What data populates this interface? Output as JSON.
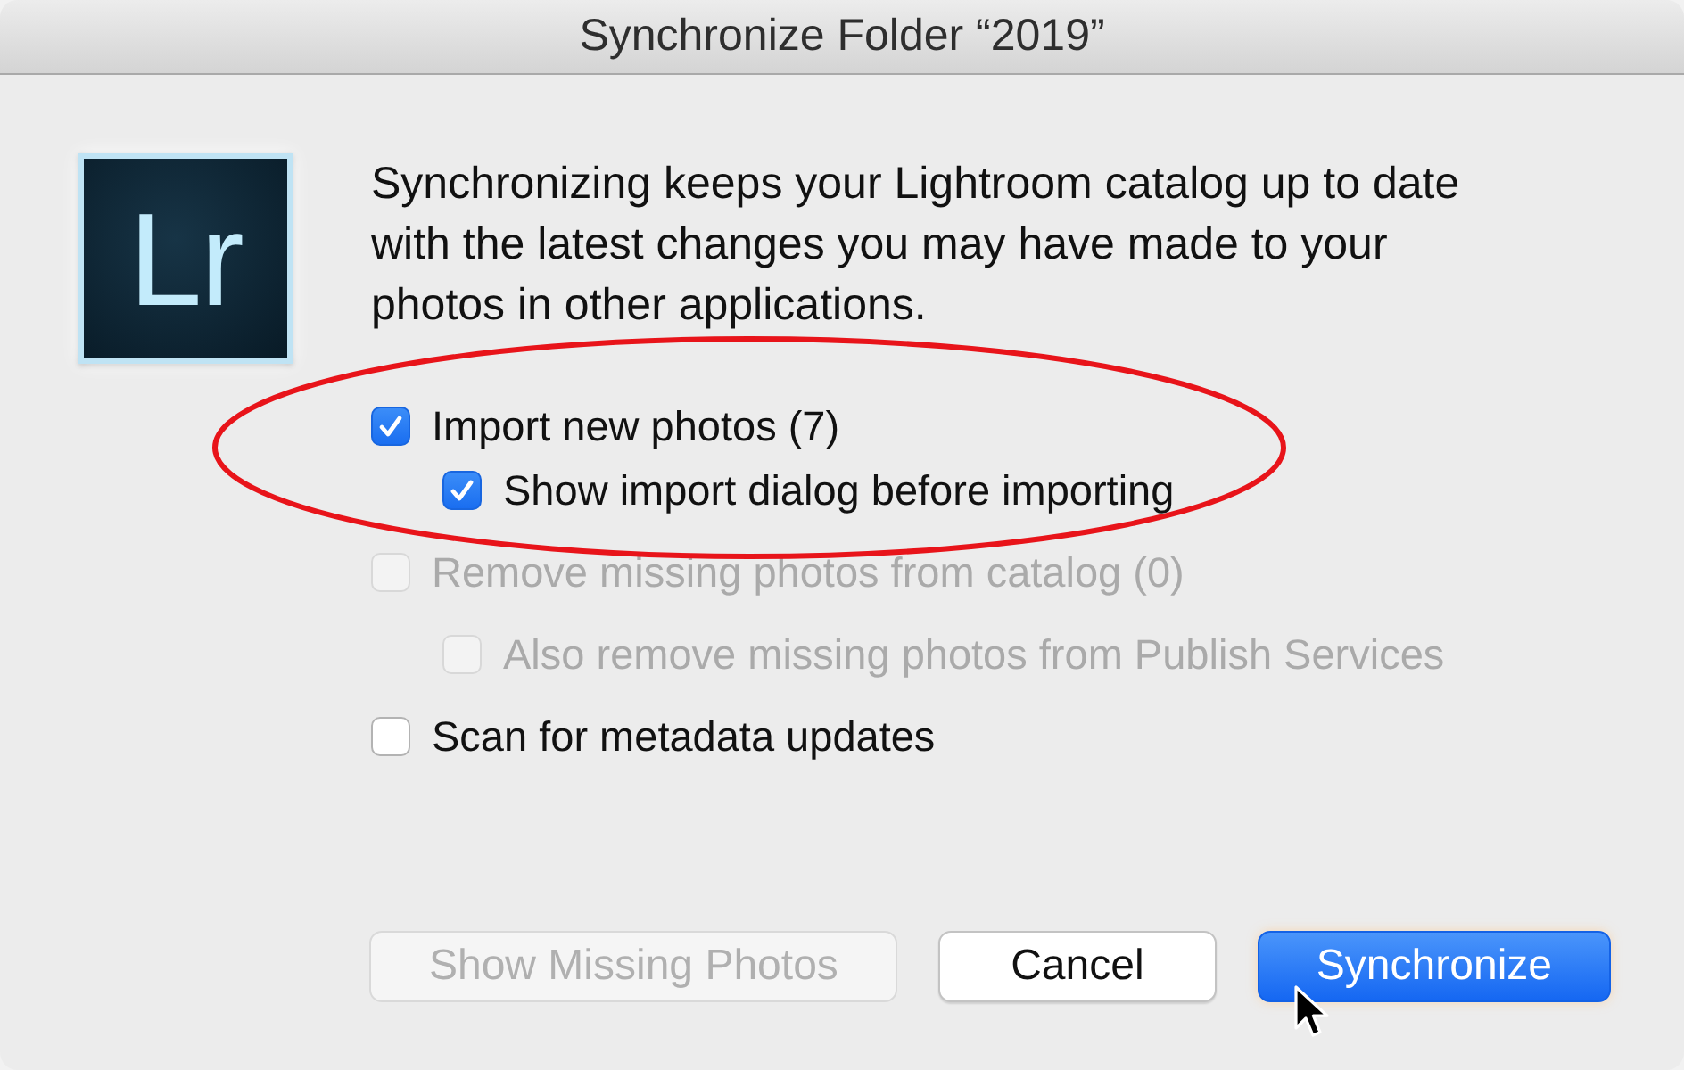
{
  "window": {
    "title": "Synchronize Folder “2019”"
  },
  "app_logo": {
    "text": "Lr"
  },
  "message": "Synchronizing keeps your Lightroom catalog up to date with the latest changes you may have made to your photos in other applications.",
  "options": [
    {
      "label": "Import new photos (7)",
      "checked": true,
      "disabled": false,
      "children": [
        {
          "label": "Show import dialog before importing",
          "checked": true,
          "disabled": false
        }
      ]
    },
    {
      "label": "Remove missing photos from catalog (0)",
      "checked": false,
      "disabled": true,
      "children": [
        {
          "label": "Also remove missing photos from Publish Services",
          "checked": false,
          "disabled": true
        }
      ]
    },
    {
      "label": "Scan for metadata updates",
      "checked": false,
      "disabled": false
    }
  ],
  "annotation": {
    "kind": "ellipse"
  },
  "buttons": [
    {
      "label": "Show Missing Photos",
      "disabled": true,
      "default": false
    },
    {
      "label": "Cancel",
      "disabled": false,
      "default": false
    },
    {
      "label": "Synchronize",
      "disabled": false,
      "default": true
    }
  ]
}
